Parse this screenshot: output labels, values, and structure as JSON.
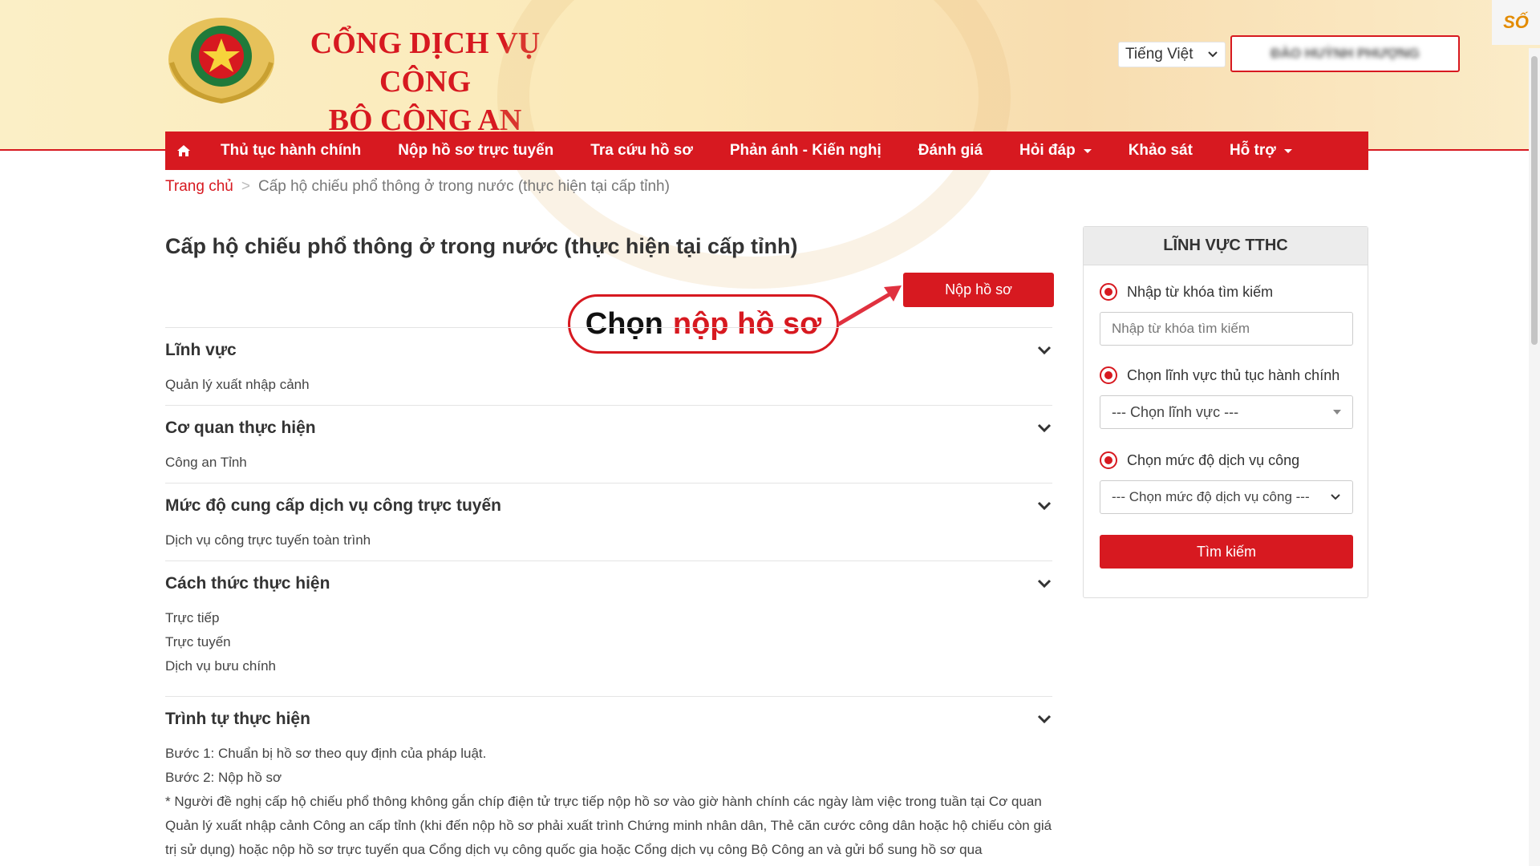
{
  "header": {
    "title_line1": "CỔNG DỊCH VỤ CÔNG",
    "title_line2": "BỘ CÔNG AN",
    "language": "Tiếng Việt",
    "user_name": "ĐÀO HUỲNH PHƯỢNG",
    "corner_badge": "SỐ"
  },
  "nav": {
    "items": [
      {
        "label": "Thủ tục hành chính"
      },
      {
        "label": "Nộp hồ sơ trực tuyến"
      },
      {
        "label": "Tra cứu hồ sơ"
      },
      {
        "label": "Phản ánh - Kiến nghị"
      },
      {
        "label": "Đánh giá"
      },
      {
        "label": "Hỏi đáp"
      },
      {
        "label": "Khảo sát"
      },
      {
        "label": "Hỗ trợ"
      }
    ]
  },
  "breadcrumb": {
    "home": "Trang chủ",
    "separator": ">",
    "current": "Cấp hộ chiếu phổ thông ở trong nước (thực hiện tại cấp tỉnh)"
  },
  "main": {
    "title": "Cấp hộ chiếu phổ thông ở trong nước (thực hiện tại cấp tỉnh)",
    "submit_label": "Nộp hồ sơ",
    "callout_a": "Chọn",
    "callout_b": "nộp hồ sơ",
    "sections": [
      {
        "title": "Lĩnh vực",
        "body": [
          "Quản lý xuất nhập cảnh"
        ]
      },
      {
        "title": "Cơ quan thực hiện",
        "body": [
          "Công an Tỉnh"
        ]
      },
      {
        "title": "Mức độ cung cấp dịch vụ công trực tuyến",
        "body": [
          "Dịch vụ công trực tuyến toàn trình"
        ]
      },
      {
        "title": "Cách thức thực hiện",
        "body": [
          "Trực tiếp",
          "Trực tuyến",
          "Dịch vụ bưu chính"
        ]
      },
      {
        "title": "Trình tự thực hiện",
        "body": [
          "Bước 1: Chuẩn bị hồ sơ theo quy định của pháp luật.",
          "Bước 2: Nộp hồ sơ",
          "* Người đề nghị cấp hộ chiếu phổ thông không gắn chíp điện tử trực tiếp nộp hồ sơ vào giờ hành chính các ngày làm việc trong tuần tại Cơ quan Quản lý xuất nhập cảnh Công an cấp tỉnh (khi đến nộp hồ sơ phải xuất trình Chứng minh nhân dân, Thẻ căn cước công dân hoặc hộ chiếu còn giá trị sử dụng) hoặc nộp hồ sơ trực tuyến qua Cổng dịch vụ công quốc gia hoặc Cổng dịch vụ công Bộ Công an và gửi bổ sung hồ sơ qua"
        ]
      }
    ]
  },
  "sidebar": {
    "title": "LĨNH VỰC TTHC",
    "radio1": "Nhập từ khóa tìm kiếm",
    "keyword_placeholder": "Nhập từ khóa tìm kiếm",
    "radio2": "Chọn lĩnh vực thủ tục hành chính",
    "field_select": "--- Chọn lĩnh vực ---",
    "radio3": "Chọn mức độ dịch vụ công",
    "level_select": "--- Chọn mức độ dịch vụ công ---",
    "search_label": "Tìm kiếm"
  },
  "colors": {
    "accent": "#d71920",
    "header_bg": "#fbefc6"
  }
}
